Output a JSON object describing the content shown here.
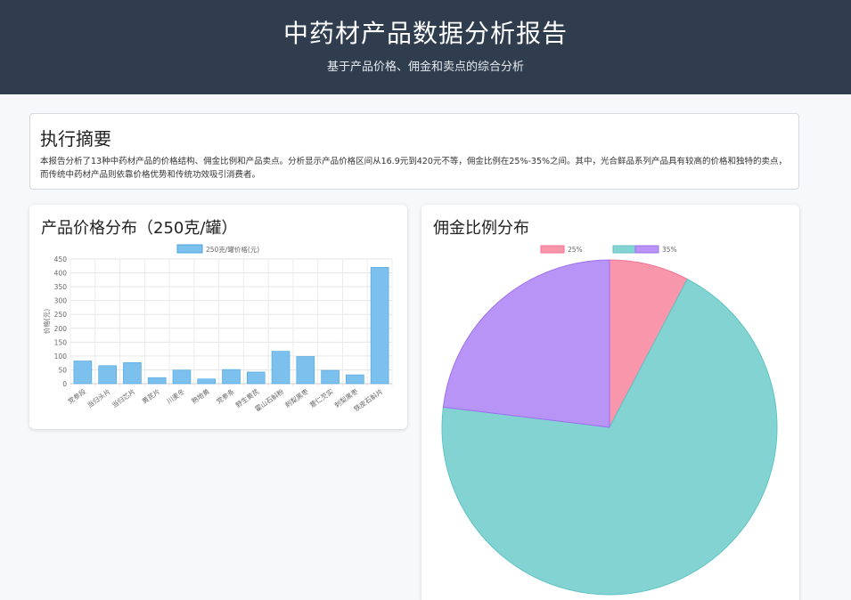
{
  "header": {
    "title": "中药材产品数据分析报告",
    "subtitle": "基于产品价格、佣金和卖点的综合分析"
  },
  "summary": {
    "title": "执行摘要",
    "text": "本报告分析了13种中药材产品的价格结构、佣金比例和产品卖点。分析显示产品价格区间从16.9元到420元不等，佣金比例在25%-35%之间。其中，光合鲜品系列产品具有较高的价格和独特的卖点，而传统中药材产品则依靠价格优势和传统功效吸引消费者。"
  },
  "bar_card": {
    "title": "产品价格分布（250克/罐）"
  },
  "pie_card": {
    "title": "佣金比例分布"
  },
  "chart_data": [
    {
      "type": "bar",
      "categories": [
        "党参段",
        "当归头片",
        "当归芯片",
        "黄芪片",
        "川麦冬",
        "熟地黄",
        "党参条",
        "野生黄芪",
        "霍山石斛粉",
        "刺梨黑枣",
        "薏仁芡实",
        "刺梨黑枣",
        "铁皮石斛片"
      ],
      "series": [
        {
          "name": "250克/罐价格(元)",
          "values": [
            82,
            65,
            76,
            22,
            49,
            17,
            51,
            42,
            117,
            98,
            48,
            32,
            420
          ]
        }
      ],
      "ylabel": "价格(元)",
      "xlabel": "",
      "ylim": [
        0,
        450
      ],
      "yticks": [
        0,
        50,
        100,
        150,
        200,
        250,
        300,
        350,
        400,
        450
      ],
      "grid": true,
      "legend": "top",
      "colors": {
        "bar": "#7cc0ee",
        "bar_border": "#4aa3df"
      }
    },
    {
      "type": "pie",
      "labels": [
        "25%",
        "30%",
        "35%"
      ],
      "values": [
        1,
        9,
        3
      ],
      "colors": [
        "#f896ab",
        "#84d3d3",
        "#b794f6"
      ],
      "borders": [
        "#f47292",
        "#5fc3c3",
        "#9f6ff0"
      ],
      "legend": "top"
    }
  ]
}
